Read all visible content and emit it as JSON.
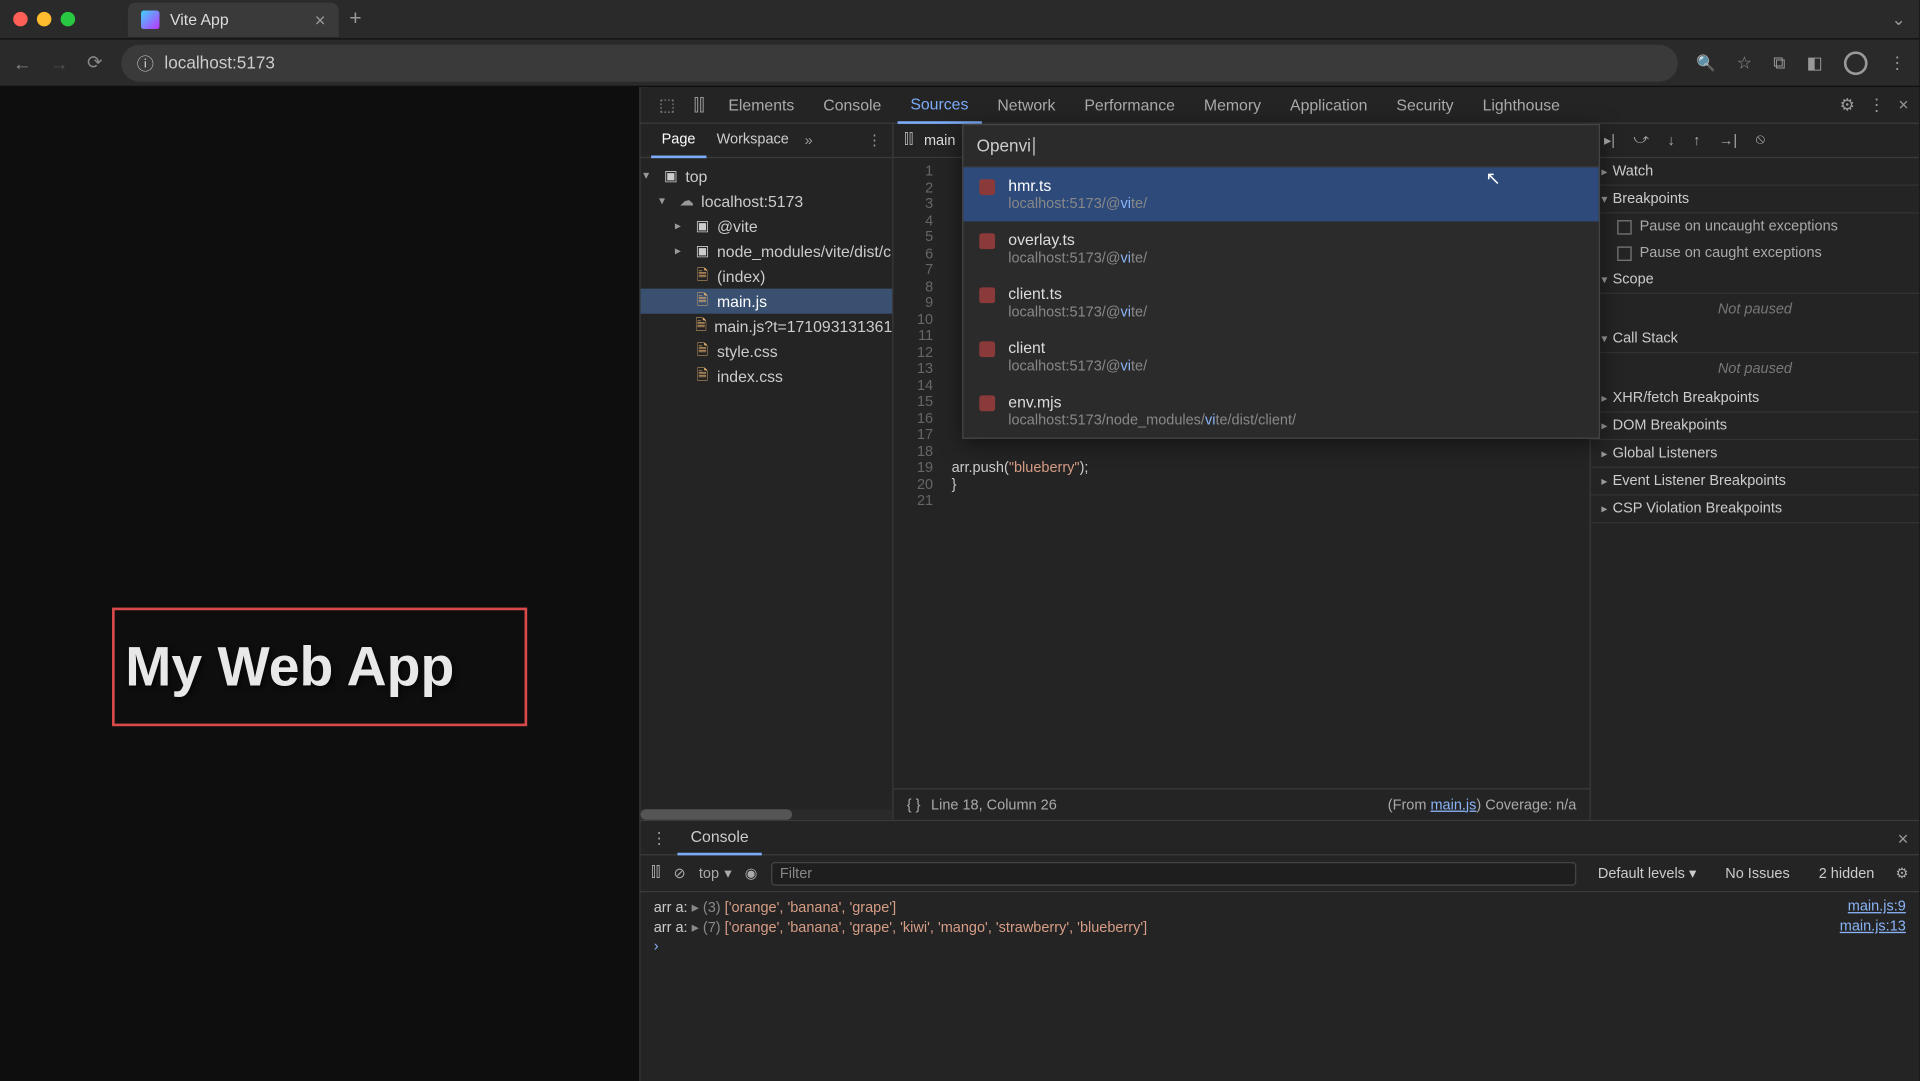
{
  "browser": {
    "tab_title": "Vite App",
    "url": "localhost:5173"
  },
  "page": {
    "heading": "My Web App"
  },
  "devtools": {
    "tabs": [
      "Elements",
      "Console",
      "Sources",
      "Network",
      "Performance",
      "Memory",
      "Application",
      "Security",
      "Lighthouse"
    ],
    "active_tab": "Sources"
  },
  "navigator": {
    "tabs": {
      "page": "Page",
      "workspace": "Workspace",
      "more": "»"
    },
    "tree": {
      "top": "top",
      "host": "localhost:5173",
      "folder1": "@vite",
      "folder2": "node_modules/vite/dist/c",
      "files": [
        "(index)",
        "main.js",
        "main.js?t=171093131361",
        "style.css",
        "index.css"
      ]
    }
  },
  "editor": {
    "open_file": "main",
    "line_count": 21,
    "code_line19_a": "arr.push(",
    "code_line19_b": "\"blueberry\"",
    "code_line19_c": ");",
    "code_line20": "}",
    "status_cursor": "Line 18, Column 26",
    "status_from": "(From ",
    "status_from_link": "main.js",
    "status_coverage": ") Coverage: n/a"
  },
  "command_menu": {
    "prefix": "Open ",
    "query": "vi",
    "items": [
      {
        "name": "hmr.ts",
        "path_a": "localhost:5173/@",
        "path_hl": "vi",
        "path_b": "te/"
      },
      {
        "name": "overlay.ts",
        "path_a": "localhost:5173/@",
        "path_hl": "vi",
        "path_b": "te/"
      },
      {
        "name": "client.ts",
        "path_a": "localhost:5173/@",
        "path_hl": "vi",
        "path_b": "te/"
      },
      {
        "name": "client",
        "path_a": "localhost:5173/@",
        "path_hl": "vi",
        "path_b": "te/"
      },
      {
        "name": "env.mjs",
        "path_a": "localhost:5173/node_modules/",
        "path_hl": "vi",
        "path_b": "te/dist/client/"
      }
    ]
  },
  "debugger": {
    "watch": "Watch",
    "breakpoints": "Breakpoints",
    "uncaught": "Pause on uncaught exceptions",
    "caught": "Pause on caught exceptions",
    "scope": "Scope",
    "not_paused": "Not paused",
    "callstack": "Call Stack",
    "xhr": "XHR/fetch Breakpoints",
    "dom": "DOM Breakpoints",
    "gl": "Global Listeners",
    "ev": "Event Listener Breakpoints",
    "csp": "CSP Violation Breakpoints"
  },
  "console": {
    "tab": "Console",
    "context": "top",
    "filter_placeholder": "Filter",
    "levels": "Default levels",
    "issues": "No Issues",
    "hidden": "2 hidden",
    "rows": [
      {
        "label": "arr a: ",
        "exp": "▸ ",
        "count": "(3)",
        "arr": " ['orange', 'banana', 'grape']",
        "src": "main.js:9"
      },
      {
        "label": "arr a: ",
        "exp": "▸ ",
        "count": "(7)",
        "arr": " ['orange', 'banana', 'grape', 'kiwi', 'mango', 'strawberry', 'blueberry']",
        "src": "main.js:13"
      }
    ]
  }
}
